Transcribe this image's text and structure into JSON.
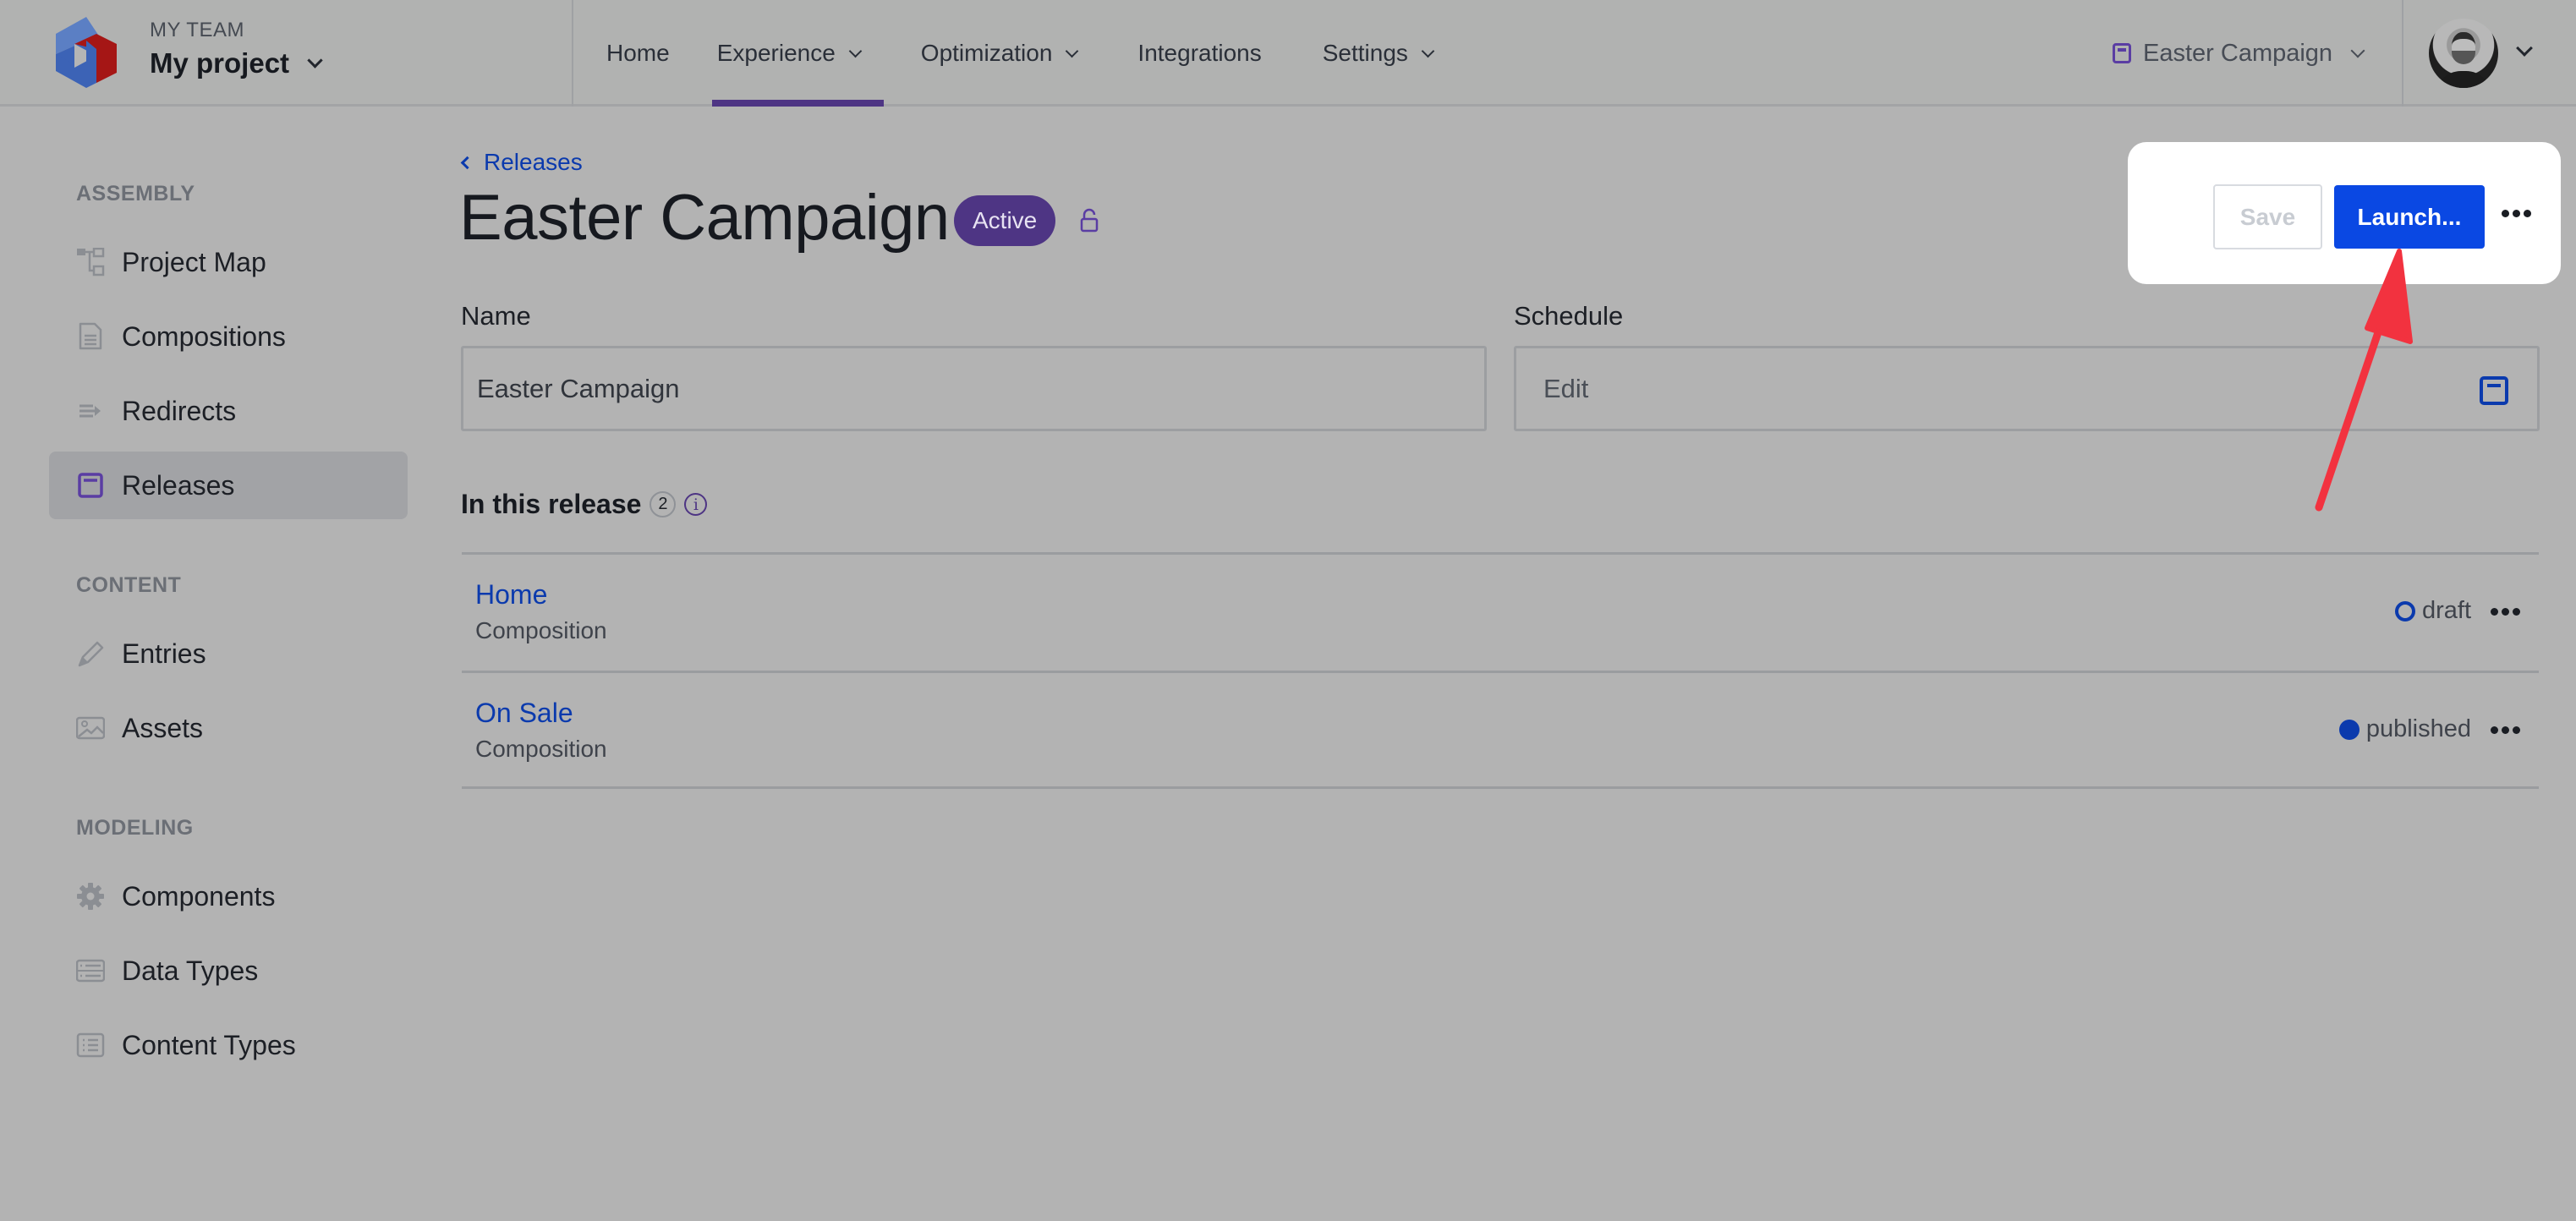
{
  "header": {
    "team_label": "MY TEAM",
    "project_name": "My project",
    "nav": [
      {
        "label": "Home",
        "has_dropdown": false,
        "active": false
      },
      {
        "label": "Experience",
        "has_dropdown": true,
        "active": true
      },
      {
        "label": "Optimization",
        "has_dropdown": true,
        "active": false
      },
      {
        "label": "Integrations",
        "has_dropdown": false,
        "active": false
      },
      {
        "label": "Settings",
        "has_dropdown": true,
        "active": false
      }
    ],
    "release_switcher": {
      "label": "Easter Campaign",
      "icon": "calendar-icon"
    },
    "avatar_alt": "user-avatar"
  },
  "sidebar": {
    "sections": [
      {
        "title": "ASSEMBLY",
        "items": [
          {
            "label": "Project Map",
            "icon": "project-map-icon",
            "active": false
          },
          {
            "label": "Compositions",
            "icon": "document-icon",
            "active": false
          },
          {
            "label": "Redirects",
            "icon": "redirect-icon",
            "active": false
          },
          {
            "label": "Releases",
            "icon": "calendar-icon",
            "active": true
          }
        ]
      },
      {
        "title": "CONTENT",
        "items": [
          {
            "label": "Entries",
            "icon": "pencil-icon",
            "active": false
          },
          {
            "label": "Assets",
            "icon": "image-icon",
            "active": false
          }
        ]
      },
      {
        "title": "MODELING",
        "items": [
          {
            "label": "Components",
            "icon": "gear-icon",
            "active": false
          },
          {
            "label": "Data Types",
            "icon": "data-types-icon",
            "active": false
          },
          {
            "label": "Content Types",
            "icon": "list-icon",
            "active": false
          }
        ]
      }
    ]
  },
  "main": {
    "breadcrumb": "Releases",
    "title": "Easter Campaign",
    "status_badge": "Active",
    "actions": {
      "save_label": "Save",
      "launch_label": "Launch..."
    },
    "form": {
      "name_label": "Name",
      "name_value": "Easter Campaign",
      "schedule_label": "Schedule",
      "schedule_value": "Edit"
    },
    "release_section": {
      "heading": "In this release",
      "count": "2",
      "items": [
        {
          "title": "Home",
          "type": "Composition",
          "status": "draft"
        },
        {
          "title": "On Sale",
          "type": "Composition",
          "status": "published"
        }
      ]
    }
  },
  "colors": {
    "accent_purple": "#4e3584",
    "primary_blue": "#0a48e3",
    "link_blue": "#0b3aad",
    "annotation_red": "#f2323f"
  }
}
